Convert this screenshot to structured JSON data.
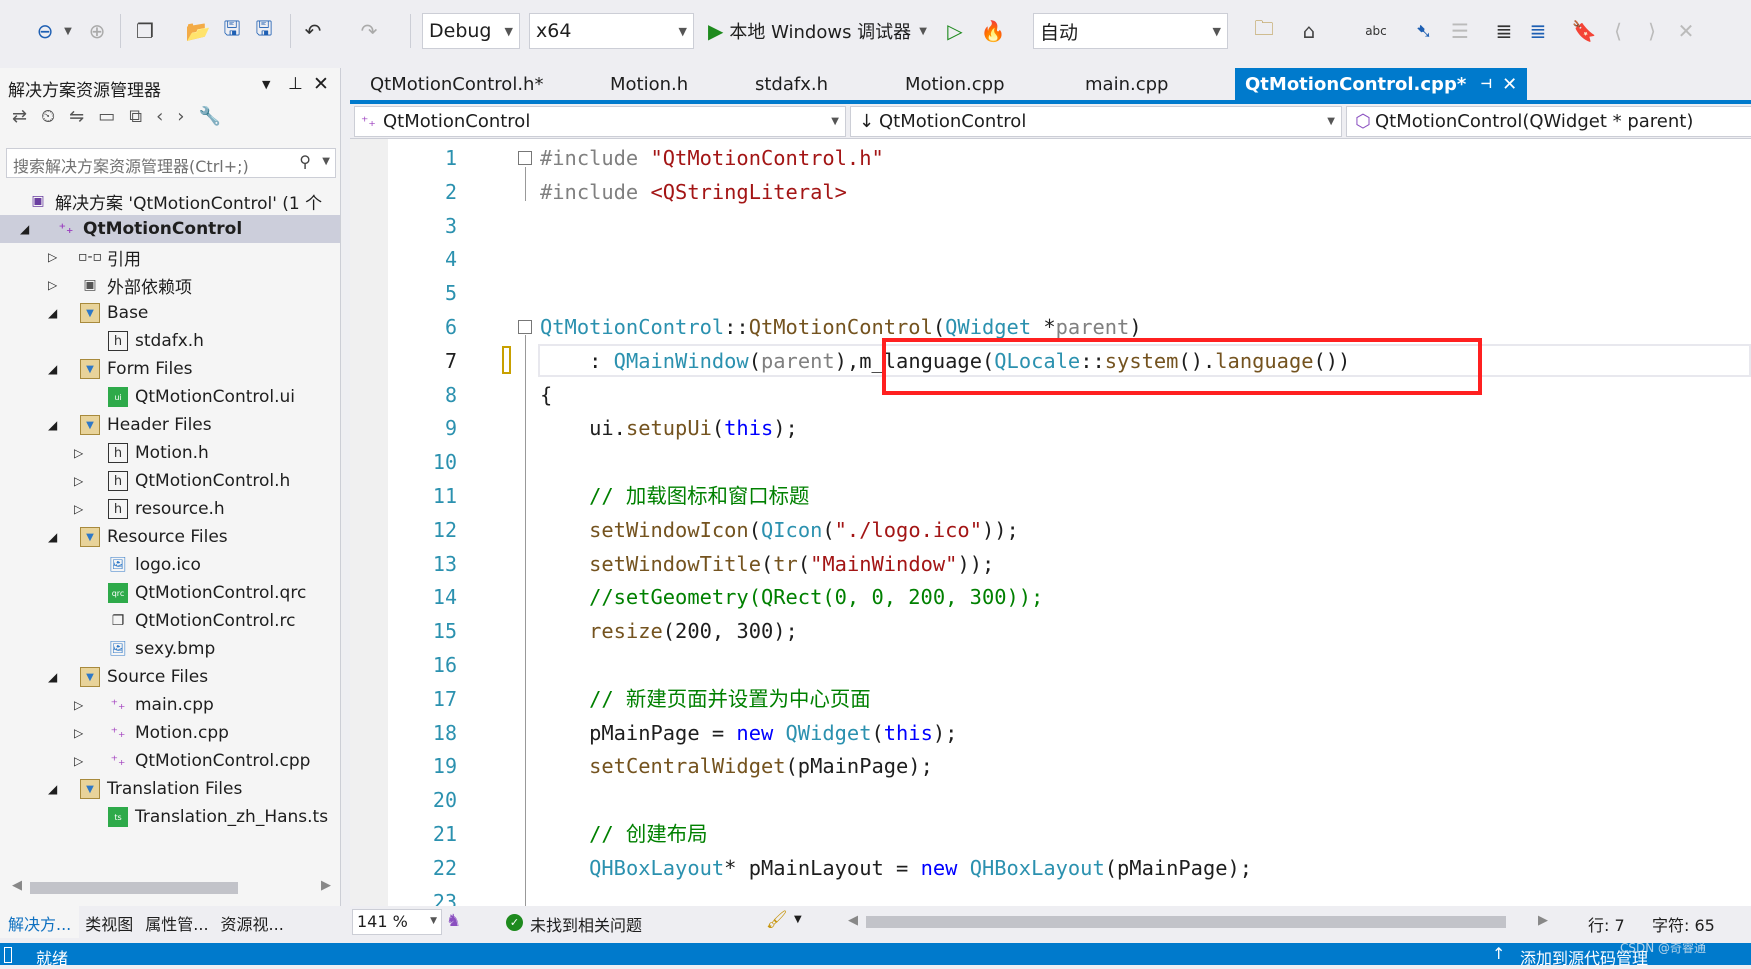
{
  "toolbar": {
    "config": "Debug",
    "platform": "x64",
    "run_label": "本地 Windows 调试器",
    "auto_combo": "自动"
  },
  "solution_explorer": {
    "title": "解决方案资源管理器",
    "search_placeholder": "搜索解决方案资源管理器(Ctrl+;)",
    "tree": [
      {
        "label": "解决方案 'QtMotionControl' (1 个",
        "icon": "solution-icon",
        "depth": 0,
        "expander": ""
      },
      {
        "label": "QtMotionControl",
        "icon": "cpp-project-icon",
        "depth": 0,
        "expander": "expanded",
        "selected": true
      },
      {
        "label": "引用",
        "icon": "references-icon",
        "depth": 1,
        "expander": "collapsed"
      },
      {
        "label": "外部依赖项",
        "icon": "external-deps-icon",
        "depth": 1,
        "expander": "collapsed"
      },
      {
        "label": "Base",
        "icon": "filter-folder-icon",
        "depth": 1,
        "expander": "expanded"
      },
      {
        "label": "stdafx.h",
        "icon": "header-file-icon",
        "depth": 2,
        "expander": ""
      },
      {
        "label": "Form Files",
        "icon": "filter-folder-icon",
        "depth": 1,
        "expander": "expanded"
      },
      {
        "label": "QtMotionControl.ui",
        "icon": "ui-file-icon",
        "depth": 2,
        "expander": ""
      },
      {
        "label": "Header Files",
        "icon": "filter-folder-icon",
        "depth": 1,
        "expander": "expanded"
      },
      {
        "label": "Motion.h",
        "icon": "header-file-icon",
        "depth": 2,
        "expander": "collapsed"
      },
      {
        "label": "QtMotionControl.h",
        "icon": "header-file-icon",
        "depth": 2,
        "expander": "collapsed"
      },
      {
        "label": "resource.h",
        "icon": "header-file-icon",
        "depth": 2,
        "expander": "collapsed"
      },
      {
        "label": "Resource Files",
        "icon": "filter-folder-icon",
        "depth": 1,
        "expander": "expanded"
      },
      {
        "label": "logo.ico",
        "icon": "image-file-icon",
        "depth": 2,
        "expander": ""
      },
      {
        "label": "QtMotionControl.qrc",
        "icon": "qrc-file-icon",
        "depth": 2,
        "expander": ""
      },
      {
        "label": "QtMotionControl.rc",
        "icon": "rc-file-icon",
        "depth": 2,
        "expander": ""
      },
      {
        "label": "sexy.bmp",
        "icon": "image-file-icon",
        "depth": 2,
        "expander": ""
      },
      {
        "label": "Source Files",
        "icon": "filter-folder-icon",
        "depth": 1,
        "expander": "expanded"
      },
      {
        "label": "main.cpp",
        "icon": "cpp-file-icon",
        "depth": 2,
        "expander": "collapsed"
      },
      {
        "label": "Motion.cpp",
        "icon": "cpp-file-icon",
        "depth": 2,
        "expander": "collapsed"
      },
      {
        "label": "QtMotionControl.cpp",
        "icon": "cpp-file-icon",
        "depth": 2,
        "expander": "collapsed"
      },
      {
        "label": "Translation Files",
        "icon": "filter-folder-icon",
        "depth": 1,
        "expander": "expanded"
      },
      {
        "label": "Translation_zh_Hans.ts",
        "icon": "ts-file-icon",
        "depth": 2,
        "expander": ""
      }
    ],
    "bottom_tabs": [
      "解决方...",
      "类视图",
      "属性管...",
      "资源视..."
    ]
  },
  "editor": {
    "tabs": [
      {
        "label": "QtMotionControl.h*",
        "active": false
      },
      {
        "label": "Motion.h",
        "active": false
      },
      {
        "label": "stdafx.h",
        "active": false
      },
      {
        "label": "Motion.cpp",
        "active": false
      },
      {
        "label": "main.cpp",
        "active": false
      },
      {
        "label": "QtMotionControl.cpp*",
        "active": true
      }
    ],
    "nav": {
      "project": "QtMotionControl",
      "scope": "QtMotionControl",
      "member": "QtMotionControl(QWidget * parent)"
    },
    "current_line": 7,
    "highlight_color": "#ff2020",
    "lines": [
      [
        [
          "#include ",
          "pp"
        ],
        [
          "\"QtMotionControl.h\"",
          "st"
        ]
      ],
      [
        [
          "#include ",
          "pp"
        ],
        [
          "<QStringLiteral>",
          "st"
        ]
      ],
      [],
      [],
      [],
      [
        [
          "QtMotionControl",
          "ty"
        ],
        [
          "::",
          "pl"
        ],
        [
          "QtMotionControl",
          "fn"
        ],
        [
          "(",
          "pl"
        ],
        [
          "QWidget",
          "ty"
        ],
        [
          " *",
          "pl"
        ],
        [
          "parent",
          "pa"
        ],
        [
          ")",
          "pl"
        ]
      ],
      [
        [
          "    : ",
          "pl"
        ],
        [
          "QMainWindow",
          "ty"
        ],
        [
          "(",
          "pl"
        ],
        [
          "parent",
          "pa"
        ],
        [
          "),m_language(",
          "pl"
        ],
        [
          "QLocale",
          "ty"
        ],
        [
          "::",
          "pl"
        ],
        [
          "system",
          "fn"
        ],
        [
          "().",
          "pl"
        ],
        [
          "language",
          "fn"
        ],
        [
          "())",
          "pl"
        ]
      ],
      [
        [
          "{",
          "pl"
        ]
      ],
      [
        [
          "    ui.",
          "pl"
        ],
        [
          "setupUi",
          "fn"
        ],
        [
          "(",
          "pl"
        ],
        [
          "this",
          "kw"
        ],
        [
          ");",
          "pl"
        ]
      ],
      [],
      [
        [
          "    // 加载图标和窗口标题",
          "cm"
        ]
      ],
      [
        [
          "    ",
          "pl"
        ],
        [
          "setWindowIcon",
          "fn"
        ],
        [
          "(",
          "pl"
        ],
        [
          "QIcon",
          "ty"
        ],
        [
          "(",
          "pl"
        ],
        [
          "\"./logo.ico\"",
          "st"
        ],
        [
          "));",
          "pl"
        ]
      ],
      [
        [
          "    ",
          "pl"
        ],
        [
          "setWindowTitle",
          "fn"
        ],
        [
          "(",
          "pl"
        ],
        [
          "tr",
          "fn"
        ],
        [
          "(",
          "pl"
        ],
        [
          "\"MainWindow\"",
          "st"
        ],
        [
          "));",
          "pl"
        ]
      ],
      [
        [
          "    //setGeometry(QRect(0, 0, 200, 300));",
          "cm"
        ]
      ],
      [
        [
          "    ",
          "pl"
        ],
        [
          "resize",
          "fn"
        ],
        [
          "(200, 300);",
          "pl"
        ]
      ],
      [],
      [
        [
          "    // 新建页面并设置为中心页面",
          "cm"
        ]
      ],
      [
        [
          "    pMainPage = ",
          "pl"
        ],
        [
          "new ",
          "kw"
        ],
        [
          "QWidget",
          "ty"
        ],
        [
          "(",
          "pl"
        ],
        [
          "this",
          "kw"
        ],
        [
          ");",
          "pl"
        ]
      ],
      [
        [
          "    ",
          "pl"
        ],
        [
          "setCentralWidget",
          "fn"
        ],
        [
          "(pMainPage);",
          "pl"
        ]
      ],
      [],
      [
        [
          "    // 创建布局",
          "cm"
        ]
      ],
      [
        [
          "    ",
          "pl"
        ],
        [
          "QHBoxLayout",
          "ty"
        ],
        [
          "* pMainLayout = ",
          "pl"
        ],
        [
          "new ",
          "kw"
        ],
        [
          "QHBoxLayout",
          "ty"
        ],
        [
          "(pMainPage);",
          "pl"
        ]
      ],
      []
    ],
    "zoom": "141 %",
    "issues": "未找到相关问题",
    "row": "行: 7",
    "col": "字符: 65"
  },
  "statusbar": {
    "state": "就绪",
    "source_control": "添加到源代码管理",
    "watermark": "CSDN @奇睿通"
  }
}
